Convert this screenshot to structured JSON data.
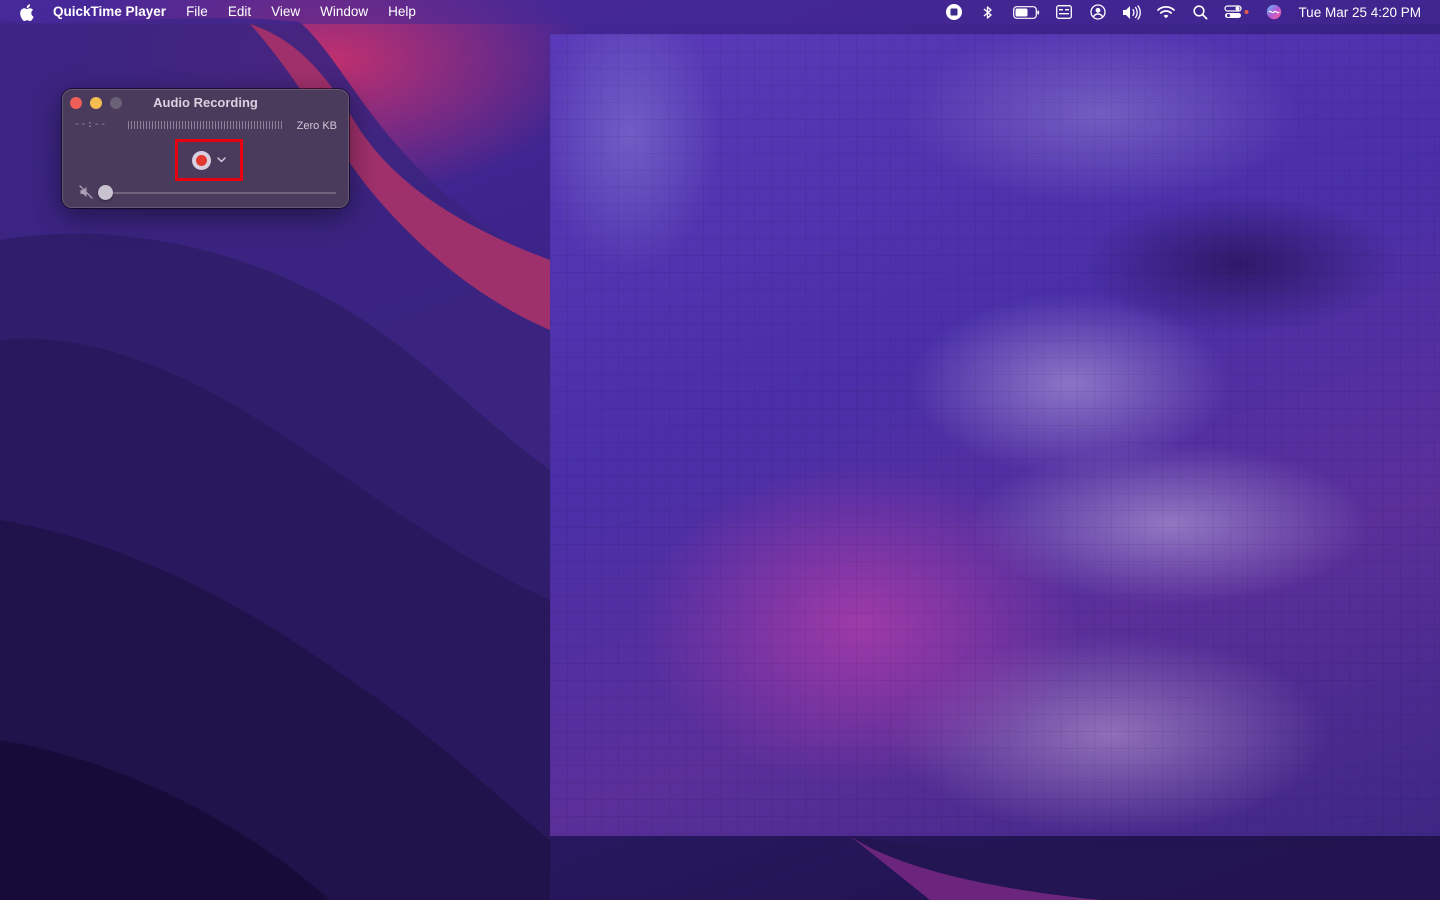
{
  "menubar": {
    "apple_icon": "apple-logo-icon",
    "app_name": "QuickTime Player",
    "menus": [
      "File",
      "Edit",
      "View",
      "Window",
      "Help"
    ],
    "status_icons": [
      "screen-recording-stop-icon",
      "bluetooth-icon",
      "battery-icon",
      "input-source-icon",
      "user-account-icon",
      "volume-icon",
      "wifi-icon",
      "spotlight-search-icon",
      "control-center-icon",
      "siri-icon"
    ],
    "clock": "Tue Mar 25  4:20 PM"
  },
  "recording_window": {
    "title": "Audio Recording",
    "elapsed_time": "--:--",
    "file_size": "Zero KB",
    "record_button_icon": "record-icon",
    "options_icon": "chevron-down-icon",
    "mute_icon": "speaker-muted-icon",
    "volume_level": 0,
    "highlight_color": "#e60012"
  },
  "colors": {
    "record_red": "#e3392f",
    "close_light": "#ee5f57",
    "minimize_light": "#f4bd4f",
    "window_bg": "#4a3a5c"
  }
}
